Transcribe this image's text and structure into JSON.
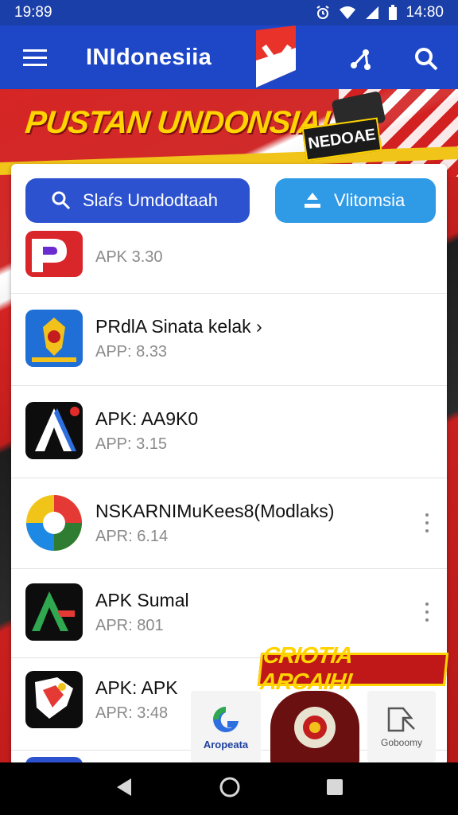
{
  "status_bar": {
    "time_left": "19:89",
    "time_right": "14:80"
  },
  "app_bar": {
    "title": "INIdonesiia"
  },
  "banner": {
    "headline": "PUSTAN UNDONSIA!",
    "box_text": "NEDOAE"
  },
  "actions": {
    "search_label": "Slaŕs Umdodtaah",
    "indonesia_label": "Vlitomsia"
  },
  "apps": [
    {
      "name": "",
      "meta": "APK 3.30",
      "icon": "red-arrow-app-icon"
    },
    {
      "name": "PRdlA Sinata kelak ›",
      "meta": "APP: 8.33",
      "icon": "garuda-emblem-icon"
    },
    {
      "name": "APK: AA9K0",
      "meta": "APP: 3.15",
      "icon": "letter-a-app-icon"
    },
    {
      "name": "NSKARNIMuKees8(Modlaks)",
      "meta": "APR: 6.14",
      "icon": "colorful-circle-app-icon"
    },
    {
      "name": "APK Sumal",
      "meta": "APR: 801",
      "icon": "green-a-app-icon"
    },
    {
      "name": "APK: APK",
      "meta": "APR: 3:48",
      "icon": "map-app-icon"
    }
  ],
  "promo": {
    "label": "CRIOTIA ARCAIH!"
  },
  "tiles": {
    "g_label": "Aropeata",
    "book_label": "Goboomy"
  },
  "colors": {
    "app_bar": "#1e47c8",
    "status_bar": "#1b3fa8",
    "pill_search": "#2d52cf",
    "pill_indo": "#2f9ae6",
    "banner_yellow": "#ffd400",
    "banner_red": "#d62525"
  }
}
